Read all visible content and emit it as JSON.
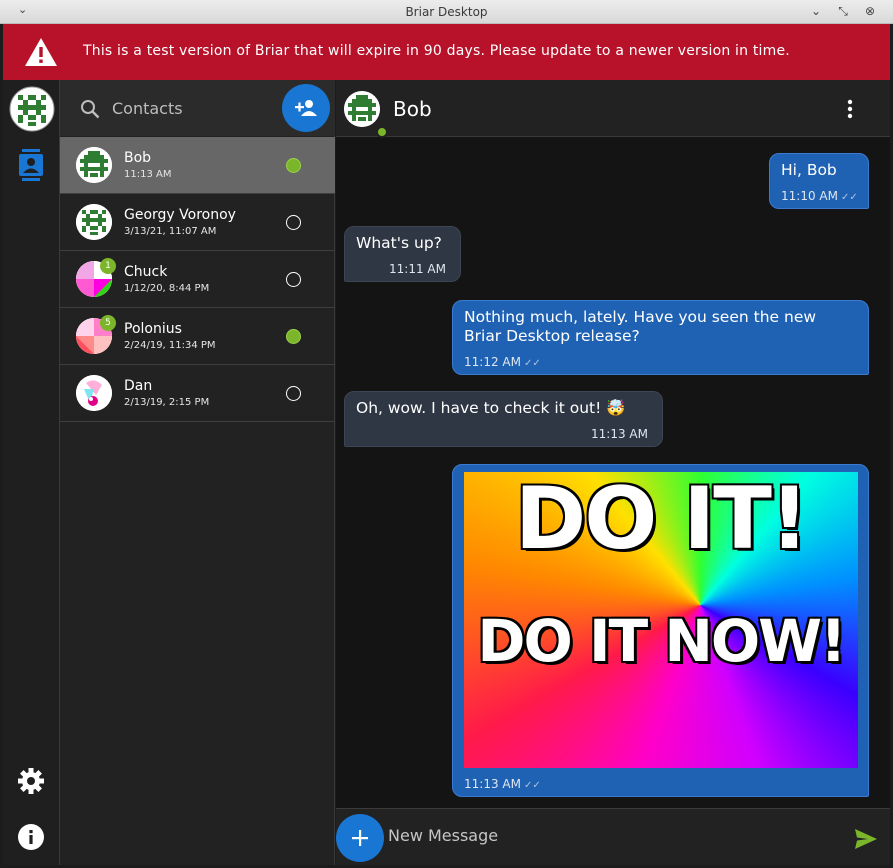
{
  "window": {
    "title": "Briar Desktop"
  },
  "banner": {
    "text": "This is a test version of Briar that will expire in 90 days. Please update to a newer version in time.",
    "color": "#b7122a"
  },
  "search": {
    "label": "Contacts"
  },
  "contacts": [
    {
      "name": "Bob",
      "time": "11:13 AM",
      "online": true,
      "unread": ""
    },
    {
      "name": "Georgy Voronoy",
      "time": "3/13/21, 11:07 AM",
      "online": false,
      "unread": ""
    },
    {
      "name": "Chuck",
      "time": "1/12/20, 8:44 PM",
      "online": false,
      "unread": "1"
    },
    {
      "name": "Polonius",
      "time": "2/24/19, 11:34 PM",
      "online": true,
      "unread": "5"
    },
    {
      "name": "Dan",
      "time": "2/13/19, 2:15 PM",
      "online": false,
      "unread": ""
    }
  ],
  "conversation": {
    "contact_name": "Bob",
    "messages": [
      {
        "direction": "out",
        "text": "Hi, Bob",
        "time": "11:10 AM"
      },
      {
        "direction": "in",
        "text": "What's up?",
        "time": "11:11 AM"
      },
      {
        "direction": "out",
        "text_line1": "Nothing much, lately. Have you seen the new",
        "text_line2": "Briar Desktop release?",
        "time": "11:12 AM"
      },
      {
        "direction": "in",
        "text": "Oh, wow. I have to check it out! 🤯",
        "time": "11:13 AM"
      },
      {
        "direction": "out",
        "image_line1": "DO IT!",
        "image_line2": "DO IT NOW!",
        "time": "11:13 AM"
      }
    ]
  },
  "composer": {
    "placeholder": "New Message"
  },
  "colors": {
    "accent": "#1976d2",
    "online": "#7bb62a",
    "outgoing_bubble": "#1f62b3",
    "incoming_bubble": "#2e3743"
  }
}
